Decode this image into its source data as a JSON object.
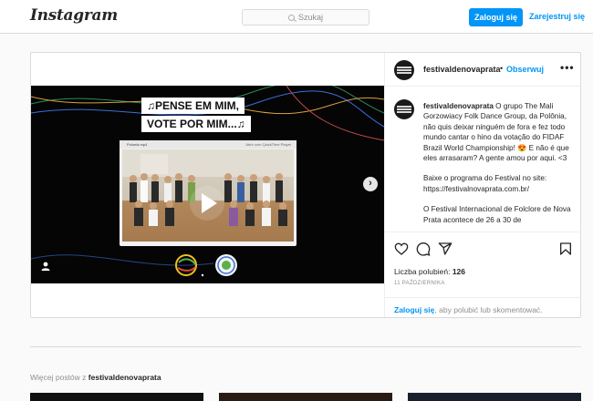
{
  "topbar": {
    "logo": "Instagram",
    "search_placeholder": "Szukaj",
    "login_label": "Zaloguj się",
    "register_label": "Zarejestruj się"
  },
  "post": {
    "username": "festivaldenovaprata",
    "follow_label": "Obserwuj",
    "more_label": "•••",
    "media": {
      "banner_line1": "♫PENSE EM MIM,",
      "banner_line2": "VOTE POR MIM...♫",
      "video_title": "Polonia.mp4",
      "video_player_label": "Abrir com QuickTime Player"
    },
    "caption": {
      "username": "festivaldenovaprata",
      "text": " O grupo The Mali Gorzowiacy Folk Dance Group, da Polônia, não quis deixar ninguém de fora e fez todo mundo cantar o hino da votação do FIDAF Brazil World Championship! 😍 E não é que eles arrasaram? A gente amou por aqui. <3",
      "paragraph2": "Baixe o programa do Festival no site: https://festivalnovaprata.com.br/",
      "paragraph3": "O Festival Internacional de Folclore de Nova Prata acontece de 26 a 30 de"
    },
    "likes_label": "Liczba polubień:",
    "likes_count": "126",
    "date": "11 PAŹDZIERNIKA",
    "footer_login": "Zaloguj się",
    "footer_rest": ", aby polubić lub skomentować."
  },
  "more_posts": {
    "prefix": "Więcej postów z ",
    "username": "festivaldenovaprata"
  },
  "colors": {
    "accent": "#0095f6",
    "border": "#dbdbdb",
    "background": "#fafafa"
  },
  "icons": [
    "search-icon",
    "play-icon",
    "chevron-right-icon",
    "user-tag-icon",
    "heart-icon",
    "comment-icon",
    "share-icon",
    "bookmark-icon",
    "more-icon"
  ]
}
